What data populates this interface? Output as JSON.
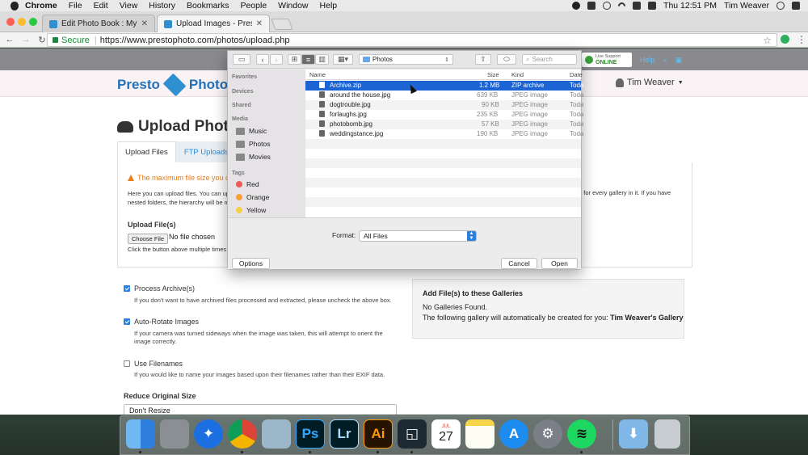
{
  "menubar": {
    "app": "Chrome",
    "items": [
      "File",
      "Edit",
      "View",
      "History",
      "Bookmarks",
      "People",
      "Window",
      "Help"
    ],
    "clock": "Thu 12:51 PM",
    "user": "Tim Weaver"
  },
  "browser": {
    "tabs": [
      {
        "title": "Edit Photo Book : My Year - Pr"
      },
      {
        "title": "Upload Images - PrestoPhoto"
      }
    ],
    "secure_label": "Secure",
    "url": "https://www.prestophoto.com/photos/upload.php"
  },
  "site": {
    "live_support_top": "Live Support",
    "live_support_status": "ONLINE",
    "help_label": "Help",
    "logo_left": "Presto",
    "logo_right": "Photo",
    "user_name": "Tim Weaver"
  },
  "upload_page": {
    "title": "Upload Photo",
    "tabs": [
      "Upload Files",
      "FTP Uploads"
    ],
    "warning": "The maximum file size you can",
    "intro_line1": "Here you can upload files. You can uplo",
    "intro_line2": "nested folders, the hierarchy will be ma",
    "intro_right": "d for every gallery in it. If you have",
    "upload_label": "Upload File(s)",
    "choose_button": "Choose File",
    "no_file": "No file chosen",
    "hint": "Click the button above multiple times t",
    "options": [
      {
        "label": "Process Archive(s)",
        "checked": true,
        "desc": "If you don't want to have archived files processed and extracted, please uncheck the above box."
      },
      {
        "label": "Auto-Rotate Images",
        "checked": true,
        "desc": "If your camera was turned sideways when the image was taken, this will attempt to orient the image correctly."
      },
      {
        "label": "Use Filenames",
        "checked": false,
        "desc": "If you would like to name your images based upon their filenames rather than their EXIF data."
      }
    ],
    "reduce_label": "Reduce Original Size",
    "reduce_value": "Don't Resize",
    "galleries": {
      "title": "Add File(s) to these Galleries",
      "none": "No Galleries Found.",
      "auto_prefix": "The following gallery will automatically be created for you:",
      "auto_name": "Tim Weaver's Gallery"
    }
  },
  "dialog": {
    "location": "Photos",
    "search_placeholder": "Search",
    "sidebar": {
      "sections": [
        "Favorites",
        "Devices",
        "Shared",
        "Media",
        "Tags"
      ],
      "media": [
        "Music",
        "Photos",
        "Movies"
      ],
      "tags": [
        {
          "name": "Red",
          "color": "#ec5b56"
        },
        {
          "name": "Orange",
          "color": "#f5a13a"
        },
        {
          "name": "Yellow",
          "color": "#f4d047"
        }
      ]
    },
    "columns": {
      "name": "Name",
      "size": "Size",
      "kind": "Kind",
      "date": "Date"
    },
    "files": [
      {
        "name": "Archive.zip",
        "size": "1.2 MB",
        "kind": "ZIP archive",
        "date": "Toda",
        "selected": true
      },
      {
        "name": "around the house.jpg",
        "size": "639 KB",
        "kind": "JPEG image",
        "date": "Toda"
      },
      {
        "name": "dogtrouble.jpg",
        "size": "90 KB",
        "kind": "JPEG image",
        "date": "Toda"
      },
      {
        "name": "forlaughs.jpg",
        "size": "235 KB",
        "kind": "JPEG image",
        "date": "Toda"
      },
      {
        "name": "photobomb.jpg",
        "size": "57 KB",
        "kind": "JPEG image",
        "date": "Toda"
      },
      {
        "name": "weddingstance.jpg",
        "size": "190 KB",
        "kind": "JPEG image",
        "date": "Toda"
      }
    ],
    "format_label": "Format:",
    "format_value": "All Files",
    "options_button": "Options",
    "cancel_button": "Cancel",
    "open_button": "Open"
  },
  "dock": {
    "calendar_month": "JUL",
    "calendar_day": "27"
  },
  "colors": {
    "accent": "#2e8fd1",
    "selection": "#1c63d4",
    "warning": "#e97e1a",
    "secure": "#168a3c"
  }
}
